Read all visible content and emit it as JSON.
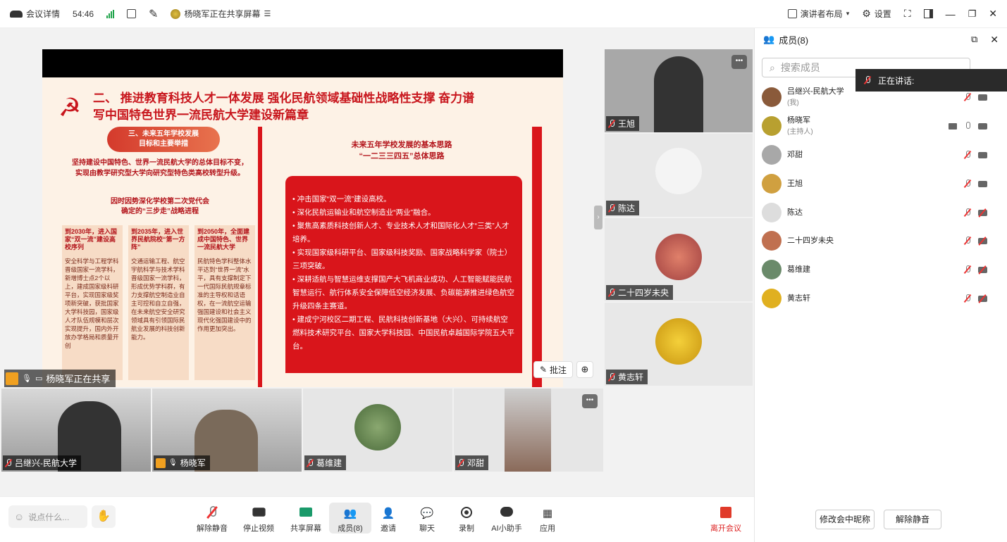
{
  "topbar": {
    "meeting_details": "会议详情",
    "timer": "54:46",
    "sharing_status": "杨晓军正在共享屏幕",
    "presenter_layout": "演讲者布局",
    "settings": "设置"
  },
  "slide": {
    "title_line1": "二、 推进教育科技人才一体发展 强化民航领域基础性战略性支撑 奋力谱",
    "title_line2": "写中国特色世界一流民航大学建设新篇章",
    "pill_line1": "三、未来五年学校发展",
    "pill_line2": "目标和主要举措",
    "left_text_line1": "坚持建设中国特色、世界一流民航大学的总体目标不变，",
    "left_text_line2": "实现由教学研究型大学向研究型特色类高校转型升级。",
    "left_sub_line1": "因时因势深化学校第二次党代会",
    "left_sub_line2": "确定的“三步走”战略进程",
    "columns": [
      {
        "head": "到2030年，进入国家“双一流”建设高校序列",
        "body": "安全科学与工程学科晋级国家一流学科，新增博士点2个以上，建成国家级科研平台，实现国家级奖项新突破，获批国家大学科技园，国家级人才队伍规模和层次实现提升，国内外开放办学格局和质量开创"
      },
      {
        "head": "到2035年，进入世界民航院校“第一方阵”",
        "body": "交通运输工程、航空宇航科学与技术学科晋级国家一流学科，形成优势学科群，有力支撑航空制造业自主可控和自立自强，在未来航空安全研究领域具有引领国际民航业发展的科技创新能力。"
      },
      {
        "head": "到2050年，全面建成中国特色、世界一流民航大学",
        "body": "民航特色学科整体水平达到“世界一流”水平，具有支撑制定下一代国际民航规章标准的主导权和话语权，在一流航空运输强国建设和社会主义现代化强国建设中的作用更加突出。"
      }
    ],
    "right_title_line1": "未来五年学校发展的基本思路",
    "right_title_line2": "“一二三三四五”总体思路",
    "bullets": [
      "• 冲击国家“双一流”建设高校。",
      "• 深化民航运输业和航空制造业“两业”融合。",
      "• 聚焦高素质科技创新人才、专业技术人才和国际化人才“三类”人才培养。",
      "• 实现国家级科研平台、国家级科技奖励、国家战略科学家（院士）三项突破。",
      "• 深耕适航与智慧运维支撑国产大飞机商业成功、人工智能赋能民航智慧运行、航行体系安全保障低空经济发展、负碳能源推进绿色航空升级四条主赛道。",
      "• 建成宁河校区二期工程、民航科技创新基地（大兴）、可持续航空燃料技术研究平台、国家大学科技园、中国民航卓越国际学院五大平台。"
    ]
  },
  "stage": {
    "share_label": "杨晓军正在共享",
    "annotate": "批注"
  },
  "thumbs": [
    {
      "name": "王旭"
    },
    {
      "name": "陈达"
    },
    {
      "name": "二十四岁未央"
    },
    {
      "name": "黄志轩"
    }
  ],
  "bottom_tiles": [
    {
      "name": "吕继兴-民航大学"
    },
    {
      "name": "杨晓军"
    },
    {
      "name": "葛维建"
    },
    {
      "name": "邓甜"
    }
  ],
  "toolbar": {
    "chat_placeholder": "说点什么...",
    "unmute": "解除静音",
    "stop_video": "停止视频",
    "share_screen": "共享屏幕",
    "members": "成员(8)",
    "invite": "邀请",
    "chat": "聊天",
    "record": "录制",
    "ai_assistant": "AI小助手",
    "apps": "应用",
    "leave": "离开会议"
  },
  "panel": {
    "title": "成员(8)",
    "search_placeholder": "搜索成员",
    "speaking": "正在讲话:",
    "members": [
      {
        "name": "吕继兴-民航大学",
        "sub": "(我)",
        "color": "#8a5a3a"
      },
      {
        "name": "杨晓军",
        "sub": "(主持人)",
        "color": "#b8a030"
      },
      {
        "name": "邓甜",
        "sub": "",
        "color": "#a8a8a8"
      },
      {
        "name": "王旭",
        "sub": "",
        "color": "#d0a040"
      },
      {
        "name": "陈达",
        "sub": "",
        "color": "#dddddd"
      },
      {
        "name": "二十四岁未央",
        "sub": "",
        "color": "#c07050"
      },
      {
        "name": "葛维建",
        "sub": "",
        "color": "#6a8a6a"
      },
      {
        "name": "黄志轩",
        "sub": "",
        "color": "#e0b020"
      }
    ],
    "rename_btn": "修改会中昵称",
    "unmute_all_btn": "解除静音"
  }
}
